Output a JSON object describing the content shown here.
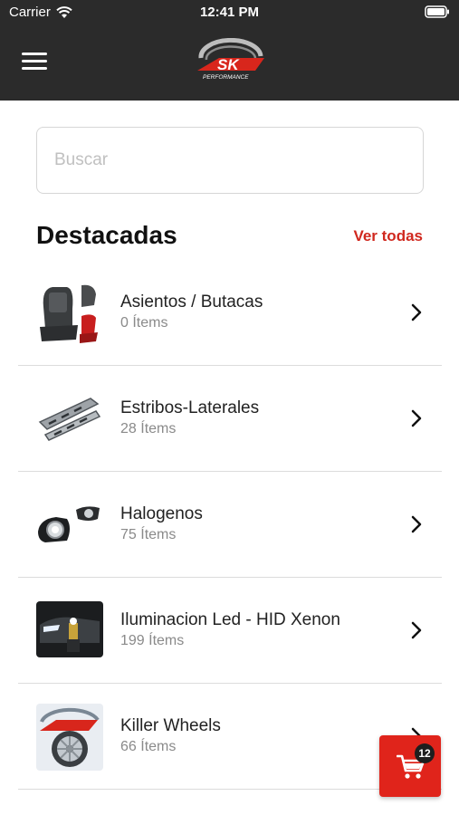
{
  "status_bar": {
    "carrier": "Carrier",
    "time": "12:41 PM"
  },
  "navbar": {
    "logo_text": "SK",
    "logo_subtitle": "PERFORMANCE"
  },
  "search": {
    "placeholder": "Buscar",
    "value": ""
  },
  "featured": {
    "title": "Destacadas",
    "see_all_label": "Ver todas",
    "items": [
      {
        "name": "Asientos / Butacas",
        "count": "0 Ítems",
        "icon": "seats-thumbnail"
      },
      {
        "name": "Estribos-Laterales",
        "count": "28 Ítems",
        "icon": "side-steps-thumbnail"
      },
      {
        "name": "Halogenos",
        "count": "75 Ítems",
        "icon": "fog-lights-thumbnail"
      },
      {
        "name": "Iluminacion Led - HID Xenon",
        "count": "199 Ítems",
        "icon": "led-bulb-thumbnail"
      },
      {
        "name": "Killer Wheels",
        "count": "66 Ítems",
        "icon": "wheel-thumbnail"
      }
    ]
  },
  "cart": {
    "count": "12"
  },
  "colors": {
    "header_bg": "#2b2b2b",
    "accent": "#d0281e",
    "cart_bg": "#e0241b"
  }
}
